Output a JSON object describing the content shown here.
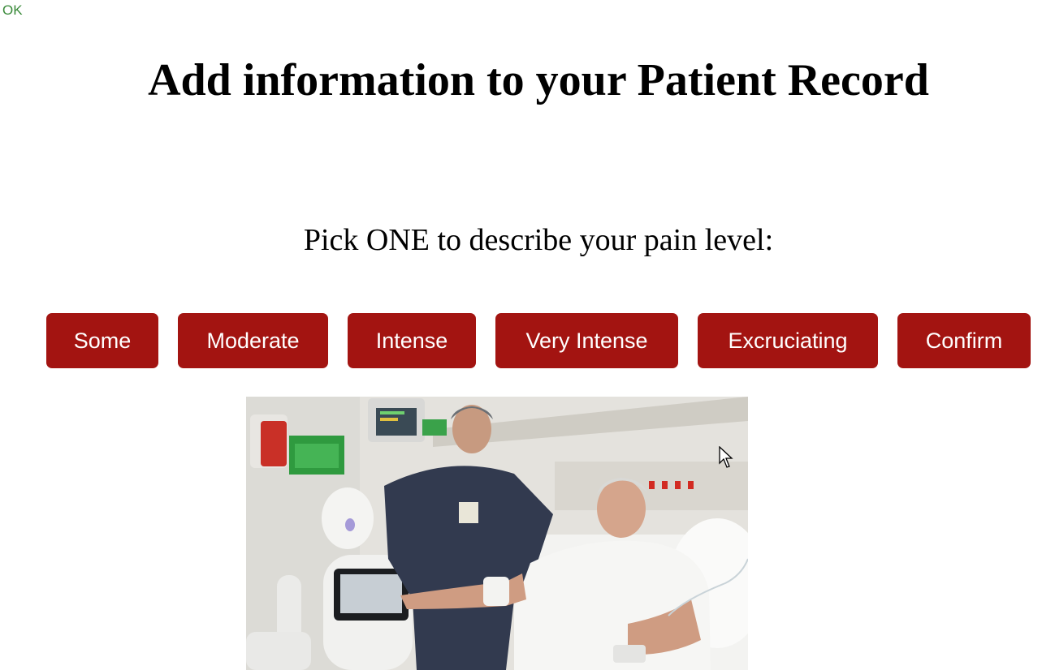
{
  "status": {
    "text": "OK"
  },
  "header": {
    "title": "Add information to your Patient Record"
  },
  "form": {
    "prompt": "Pick ONE to describe your pain level:",
    "options": [
      {
        "label": "Some"
      },
      {
        "label": "Moderate"
      },
      {
        "label": "Intense"
      },
      {
        "label": "Very Intense"
      },
      {
        "label": "Excruciating"
      }
    ],
    "confirm_label": "Confirm",
    "button_color": "#a31411"
  }
}
